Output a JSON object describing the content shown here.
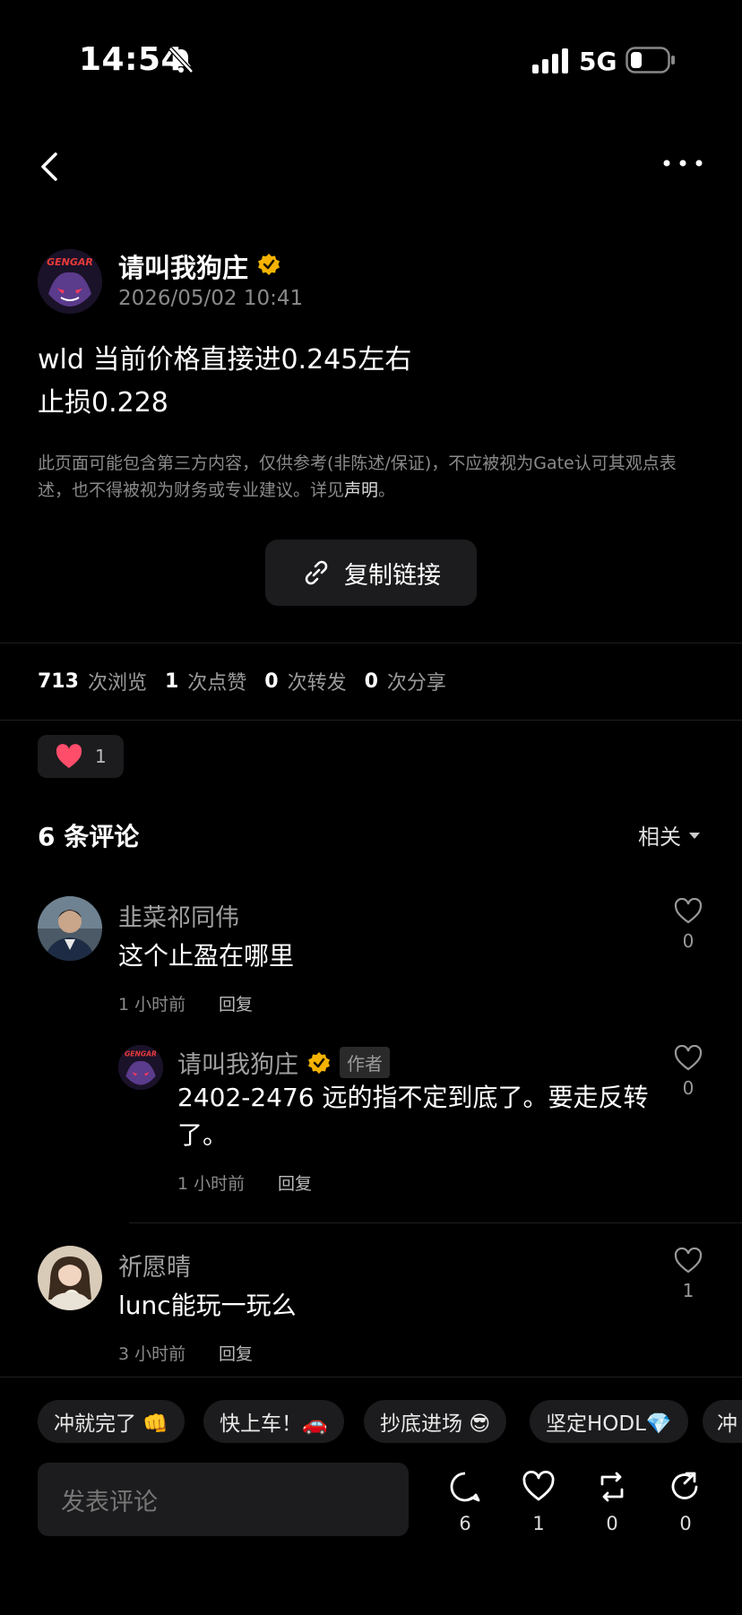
{
  "status_bar": {
    "time": "14:54",
    "network": "5G"
  },
  "post": {
    "author": "请叫我狗庄",
    "date": "2026/05/02 10:41",
    "lines": [
      "wld 当前价格直接进0.245左右",
      "止损0.228"
    ],
    "disclaimer_text": "此页面可能包含第三方内容，仅供参考(非陈述/保证)，不应被视为Gate认可其观点表述，也不得被视为财务或专业建议。详见",
    "disclaimer_link": "声明",
    "disclaimer_end": "。",
    "copy_link_label": "复制链接"
  },
  "stats": [
    {
      "value": "713",
      "label": "次浏览"
    },
    {
      "value": "1",
      "label": "次点赞"
    },
    {
      "value": "0",
      "label": "次转发"
    },
    {
      "value": "0",
      "label": "次分享"
    }
  ],
  "like_count": "1",
  "comments_header": {
    "title": "6 条评论",
    "sort": "相关"
  },
  "comments": [
    {
      "name": "韭菜祁同伟",
      "text": "这个止盈在哪里",
      "time": "1 小时前",
      "reply": "回复",
      "likes": "0"
    },
    {
      "name": "请叫我狗庄",
      "tag": "作者",
      "text1": "2402-2476 远的指不定到底了。要走反转",
      "text2": "了。",
      "time": "1 小时前",
      "reply": "回复",
      "likes": "0"
    },
    {
      "name": "祈愿晴",
      "text": "lunc能玩一玩么",
      "time": "3 小时前",
      "reply": "回复",
      "likes": "1"
    }
  ],
  "quick_replies": [
    "冲就完了 👊",
    "快上车！🚗",
    "抄底进场 😎",
    "坚定HODL💎",
    "冲"
  ],
  "composer": {
    "placeholder": "发表评论",
    "actions": [
      {
        "icon": "comment-icon",
        "count": "6"
      },
      {
        "icon": "heart-icon",
        "count": "1"
      },
      {
        "icon": "repost-icon",
        "count": "0"
      },
      {
        "icon": "share-icon",
        "count": "0"
      }
    ]
  },
  "colors": {
    "background": "#000000",
    "badge": "#f5b300",
    "heart": "#ff4d6a",
    "muted": "#8a8a8a"
  }
}
